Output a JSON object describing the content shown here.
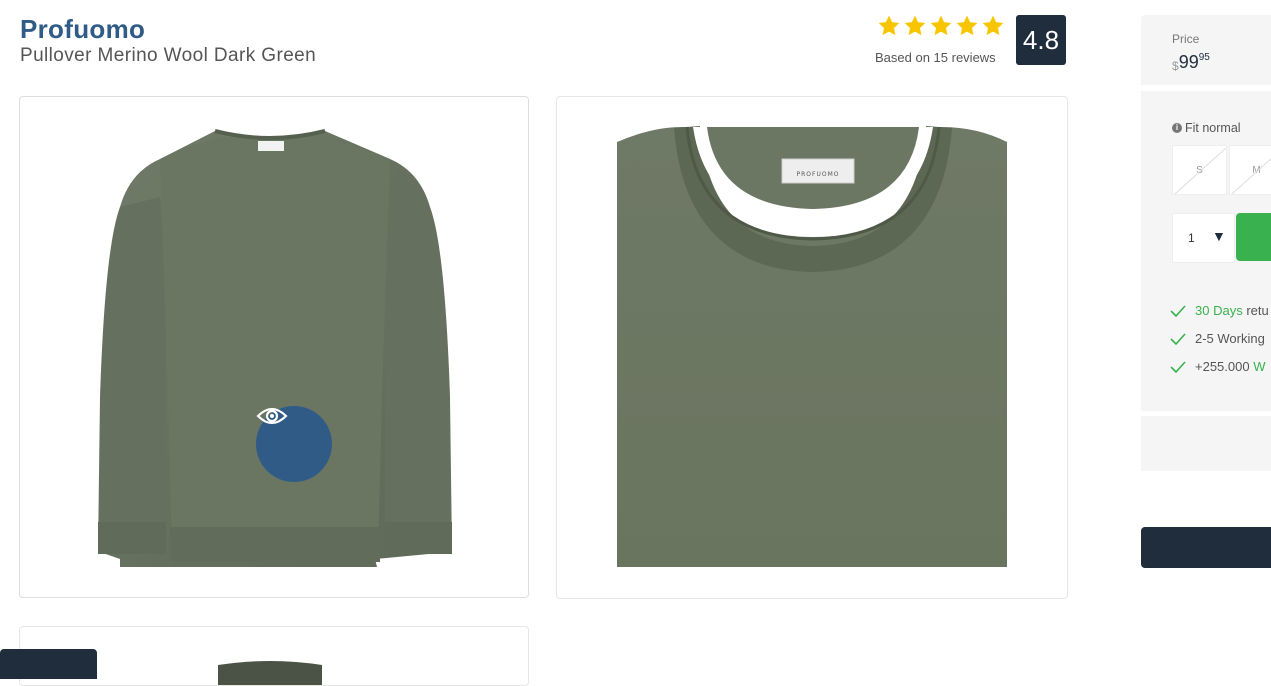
{
  "product": {
    "brand": "Profuomo",
    "name": "Pullover Merino Wool Dark Green",
    "label_text": "PROFUOMO"
  },
  "rating": {
    "stars": 5,
    "reviews_text": "Based on 15 reviews",
    "score": "4.8",
    "star_color": "#f7c600"
  },
  "buy_panel": {
    "price_label": "Price",
    "currency": "$",
    "price_main": "99",
    "price_cents": "95",
    "fit_label": "Fit normal",
    "sizes": [
      "S",
      "M"
    ],
    "quantity": "1",
    "usps": [
      {
        "highlight": "30 Days",
        "text": " retu"
      },
      {
        "highlight": "",
        "text": "2-5 Working"
      },
      {
        "highlight": "W",
        "text": "+255.000 "
      }
    ]
  },
  "icons": {
    "view": "eye-icon",
    "star": "star-icon",
    "check": "check-icon",
    "info": "info-icon",
    "dropdown": "caret-down-icon"
  },
  "colors": {
    "brand": "#2f5b86",
    "dark": "#1f2d3d",
    "accent_green": "#3ab14f",
    "sweater": "#6b7763"
  }
}
